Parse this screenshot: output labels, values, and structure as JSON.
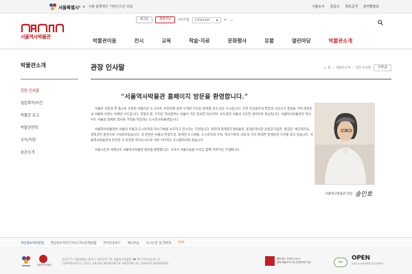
{
  "topbar": {
    "city_name": "서울특별시",
    "notice": "서울 올록제인 거버넌스단 모집",
    "links": [
      "서울소식",
      "응답소",
      "정보공개",
      "분야별정보"
    ]
  },
  "header": {
    "museum_name": "서울역사박물관",
    "buttons": [
      "로그인",
      "회원가입"
    ],
    "sitemap": "사이트맵",
    "language": "Language",
    "zoom_plus": "+",
    "zoom_minus": "−"
  },
  "gnb": [
    "박물관이용",
    "전시",
    "교육",
    "학술·자료",
    "문화행사",
    "유물",
    "열린마당",
    "박물관소개"
  ],
  "lnb": {
    "title": "박물관소개",
    "items": [
      "관장 인사말",
      "설립목적/비전",
      "박물관 로고",
      "박물관연혁",
      "조직/직원",
      "분관소개"
    ]
  },
  "content": {
    "title": "관장 인사말",
    "breadcrumb": [
      "홈",
      "박물관소개",
      "관장 인사말"
    ],
    "print": "인쇄",
    "quote": "“서울역사박물관 홈페이지 방문을 환영합니다.”",
    "paragraphs": [
      "서울은 과밀과 한 품으로 조밀된 아름다운 도시이며, 이천년에 걸쳐 누적된 두터운 층위를 갖고 있는 도시입니다. 또한 조선왕조의 한양과 식민시기 경성을 거쳐 대한민국 서울에 이르는 육백년 수도입니다. 지형의 힘, 두터운 역사층위는 서울이 가진 중요한 자산이며, 수도로만 서울의 고유한 생각이며 위상입니다. 서울역사박물관은 역사수도 서울의 정체와 역사와 기억을 저장하는 도시역사박물관입니다.",
      "서울역사박물관은 서울의 유물과 도시유적과 역사기록을 보호하고 전시하는 기관입니다. 본관과 청계천도생박물관, 동대문역사관·운동장기념관, 경교장, 백인제가옥, 경희궁터 분관으로 구성되어있습니다. 각 분관은 서울의 한양도성, 청계천 도시생활, 도시조직과 유적, 역사기록과 시대 등 각각 특색한 정체성과 가치를 갖고 있습니다. 서울역사박물관의 본관과 각 분관은 역사인식으로 서로 이어지는 도시별자리와 같습니다.",
      "서울시민과 세계인의 서울역사박물관 방문을 환영합니다. 오셔서 서울다움을 누리고 함께 지켜가길 기대합니다."
    ],
    "caption_role": "서울역사박물관 관장",
    "signature": "송인호"
  },
  "footer": {
    "links": [
      "개인정보처리방침",
      "영상정보처리기기(CCTV)운영방침",
      "뷰어다운로드",
      "배너모음",
      "오시는길 및 연락처",
      "RSS"
    ],
    "affiliate": "서울역사박물관",
    "address_lines": [
      "(03177) 서울특별시 종로구 새문안로 55 서울역사박물관 ☎ 02-724-0274~6",
      "COPYRIGHT(C) 2011. SEOUL MUSEUM OF HISTORY ALL RIGHTS RESERVED"
    ],
    "badge_web": [
      "웹어워드 코리아 2017",
      "문화/예술조직 전시관련부문 대상"
    ],
    "badge_wa": "WA",
    "badge_open": "OPEN",
    "badge_open_sub": "공공누리 공공저작물 자유이용허락"
  },
  "colors": {
    "brand": "#c41e25",
    "link_blue": "#2a5aa8",
    "rss": "#e36b1e"
  }
}
